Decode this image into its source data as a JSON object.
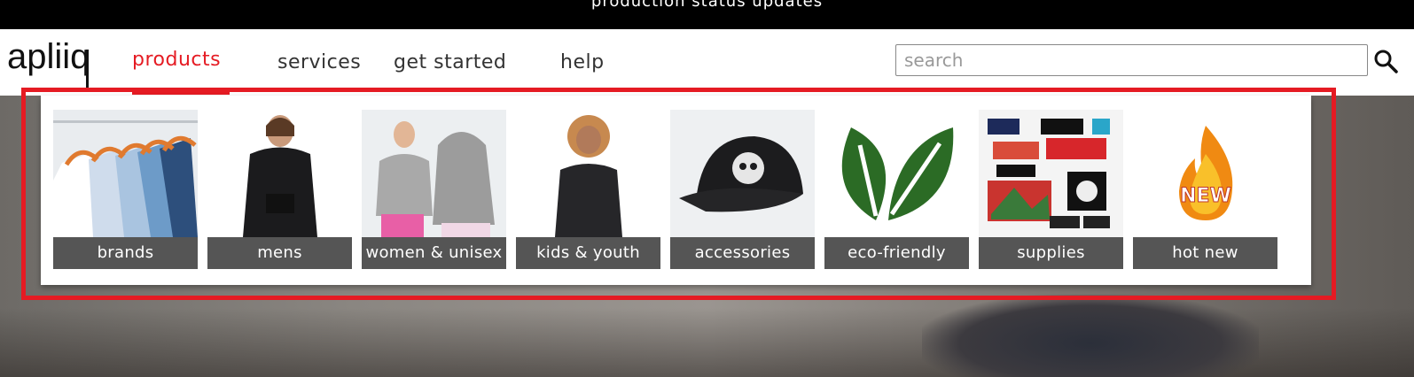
{
  "topbar": {
    "text": "production status updates"
  },
  "header": {
    "logo_text": "apliiq",
    "nav": [
      {
        "label": "products",
        "active": true
      },
      {
        "label": "services",
        "active": false
      },
      {
        "label": "get started",
        "active": false
      },
      {
        "label": "help",
        "active": false
      }
    ],
    "search": {
      "placeholder": "search",
      "value": ""
    }
  },
  "products_menu": {
    "categories": [
      {
        "label": "brands",
        "icon": "hanging-shirts-image"
      },
      {
        "label": "mens",
        "icon": "mens-hoodie-image"
      },
      {
        "label": "women & unisex",
        "icon": "women-unisex-hoodies-image"
      },
      {
        "label": "kids & youth",
        "icon": "kids-hoodie-image"
      },
      {
        "label": "accessories",
        "icon": "snapback-hat-image"
      },
      {
        "label": "eco-friendly",
        "icon": "green-leaf-image"
      },
      {
        "label": "supplies",
        "icon": "patches-labels-image"
      },
      {
        "label": "hot new",
        "icon": "fire-new-badge-image"
      }
    ]
  },
  "colors": {
    "accent": "#e51b23",
    "label_bg": "#555555",
    "topbar_bg": "#000000"
  }
}
